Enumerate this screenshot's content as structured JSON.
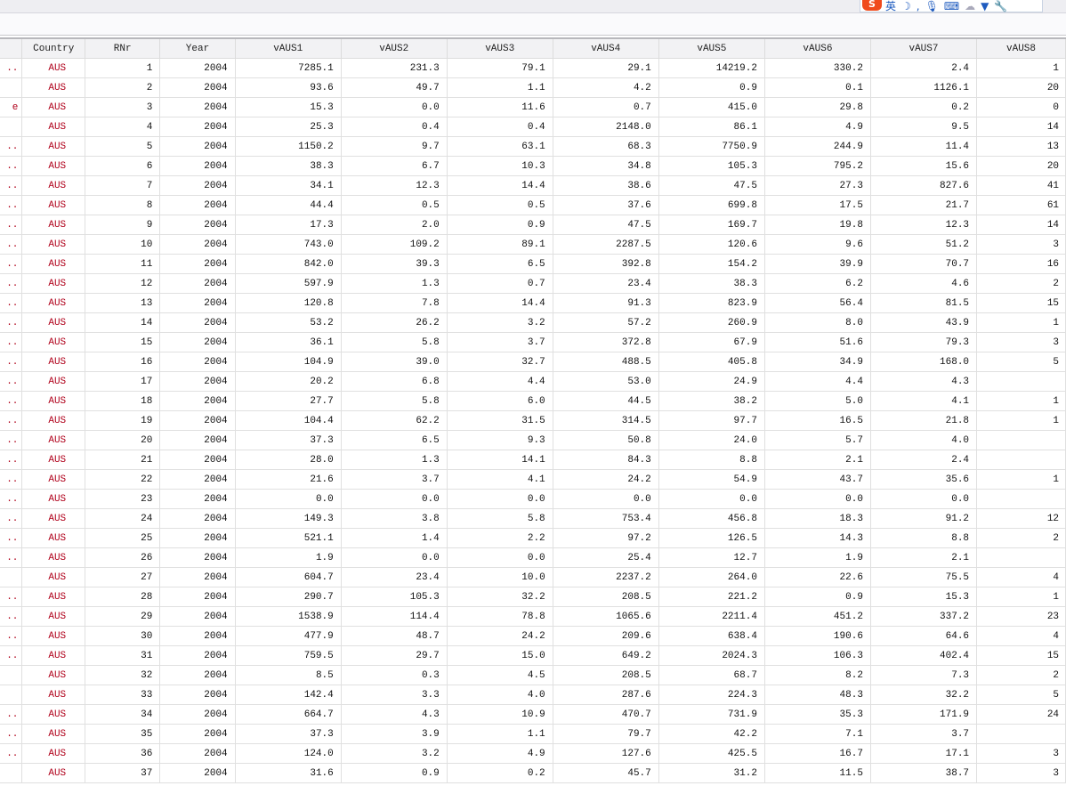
{
  "ime_toolbar": {
    "label": "英",
    "items": [
      "moon-icon",
      "punctuation-icon",
      "mic-icon",
      "keyboard-icon",
      "skin-icon",
      "shirt-icon",
      "wrench-icon"
    ]
  },
  "columns": [
    "",
    "Country",
    "RNr",
    "Year",
    "vAUS1",
    "vAUS2",
    "vAUS3",
    "vAUS4",
    "vAUS5",
    "vAUS6",
    "vAUS7",
    "vAUS8"
  ],
  "rows": [
    [
      "..",
      "AUS",
      "1",
      "2004",
      "7285.1",
      "231.3",
      "79.1",
      "29.1",
      "14219.2",
      "330.2",
      "2.4",
      "1"
    ],
    [
      "",
      "AUS",
      "2",
      "2004",
      "93.6",
      "49.7",
      "1.1",
      "4.2",
      "0.9",
      "0.1",
      "1126.1",
      "20"
    ],
    [
      "e",
      "AUS",
      "3",
      "2004",
      "15.3",
      "0.0",
      "11.6",
      "0.7",
      "415.0",
      "29.8",
      "0.2",
      "0"
    ],
    [
      "",
      "AUS",
      "4",
      "2004",
      "25.3",
      "0.4",
      "0.4",
      "2148.0",
      "86.1",
      "4.9",
      "9.5",
      "14"
    ],
    [
      "..",
      "AUS",
      "5",
      "2004",
      "1150.2",
      "9.7",
      "63.1",
      "68.3",
      "7750.9",
      "244.9",
      "11.4",
      "13"
    ],
    [
      "..",
      "AUS",
      "6",
      "2004",
      "38.3",
      "6.7",
      "10.3",
      "34.8",
      "105.3",
      "795.2",
      "15.6",
      "20"
    ],
    [
      "..",
      "AUS",
      "7",
      "2004",
      "34.1",
      "12.3",
      "14.4",
      "38.6",
      "47.5",
      "27.3",
      "827.6",
      "41"
    ],
    [
      "..",
      "AUS",
      "8",
      "2004",
      "44.4",
      "0.5",
      "0.5",
      "37.6",
      "699.8",
      "17.5",
      "21.7",
      "61"
    ],
    [
      "..",
      "AUS",
      "9",
      "2004",
      "17.3",
      "2.0",
      "0.9",
      "47.5",
      "169.7",
      "19.8",
      "12.3",
      "14"
    ],
    [
      "..",
      "AUS",
      "10",
      "2004",
      "743.0",
      "109.2",
      "89.1",
      "2287.5",
      "120.6",
      "9.6",
      "51.2",
      "3"
    ],
    [
      "..",
      "AUS",
      "11",
      "2004",
      "842.0",
      "39.3",
      "6.5",
      "392.8",
      "154.2",
      "39.9",
      "70.7",
      "16"
    ],
    [
      "..",
      "AUS",
      "12",
      "2004",
      "597.9",
      "1.3",
      "0.7",
      "23.4",
      "38.3",
      "6.2",
      "4.6",
      "2"
    ],
    [
      "..",
      "AUS",
      "13",
      "2004",
      "120.8",
      "7.8",
      "14.4",
      "91.3",
      "823.9",
      "56.4",
      "81.5",
      "15"
    ],
    [
      "..",
      "AUS",
      "14",
      "2004",
      "53.2",
      "26.2",
      "3.2",
      "57.2",
      "260.9",
      "8.0",
      "43.9",
      "1"
    ],
    [
      "..",
      "AUS",
      "15",
      "2004",
      "36.1",
      "5.8",
      "3.7",
      "372.8",
      "67.9",
      "51.6",
      "79.3",
      "3"
    ],
    [
      "..",
      "AUS",
      "16",
      "2004",
      "104.9",
      "39.0",
      "32.7",
      "488.5",
      "405.8",
      "34.9",
      "168.0",
      "5"
    ],
    [
      "..",
      "AUS",
      "17",
      "2004",
      "20.2",
      "6.8",
      "4.4",
      "53.0",
      "24.9",
      "4.4",
      "4.3",
      ""
    ],
    [
      "..",
      "AUS",
      "18",
      "2004",
      "27.7",
      "5.8",
      "6.0",
      "44.5",
      "38.2",
      "5.0",
      "4.1",
      "1"
    ],
    [
      "..",
      "AUS",
      "19",
      "2004",
      "104.4",
      "62.2",
      "31.5",
      "314.5",
      "97.7",
      "16.5",
      "21.8",
      "1"
    ],
    [
      "..",
      "AUS",
      "20",
      "2004",
      "37.3",
      "6.5",
      "9.3",
      "50.8",
      "24.0",
      "5.7",
      "4.0",
      ""
    ],
    [
      "..",
      "AUS",
      "21",
      "2004",
      "28.0",
      "1.3",
      "14.1",
      "84.3",
      "8.8",
      "2.1",
      "2.4",
      ""
    ],
    [
      "..",
      "AUS",
      "22",
      "2004",
      "21.6",
      "3.7",
      "4.1",
      "24.2",
      "54.9",
      "43.7",
      "35.6",
      "1"
    ],
    [
      "..",
      "AUS",
      "23",
      "2004",
      "0.0",
      "0.0",
      "0.0",
      "0.0",
      "0.0",
      "0.0",
      "0.0",
      ""
    ],
    [
      "..",
      "AUS",
      "24",
      "2004",
      "149.3",
      "3.8",
      "5.8",
      "753.4",
      "456.8",
      "18.3",
      "91.2",
      "12"
    ],
    [
      "..",
      "AUS",
      "25",
      "2004",
      "521.1",
      "1.4",
      "2.2",
      "97.2",
      "126.5",
      "14.3",
      "8.8",
      "2"
    ],
    [
      "..",
      "AUS",
      "26",
      "2004",
      "1.9",
      "0.0",
      "0.0",
      "25.4",
      "12.7",
      "1.9",
      "2.1",
      ""
    ],
    [
      "",
      "AUS",
      "27",
      "2004",
      "604.7",
      "23.4",
      "10.0",
      "2237.2",
      "264.0",
      "22.6",
      "75.5",
      "4"
    ],
    [
      "..",
      "AUS",
      "28",
      "2004",
      "290.7",
      "105.3",
      "32.2",
      "208.5",
      "221.2",
      "0.9",
      "15.3",
      "1"
    ],
    [
      "..",
      "AUS",
      "29",
      "2004",
      "1538.9",
      "114.4",
      "78.8",
      "1065.6",
      "2211.4",
      "451.2",
      "337.2",
      "23"
    ],
    [
      "..",
      "AUS",
      "30",
      "2004",
      "477.9",
      "48.7",
      "24.2",
      "209.6",
      "638.4",
      "190.6",
      "64.6",
      "4"
    ],
    [
      "..",
      "AUS",
      "31",
      "2004",
      "759.5",
      "29.7",
      "15.0",
      "649.2",
      "2024.3",
      "106.3",
      "402.4",
      "15"
    ],
    [
      "",
      "AUS",
      "32",
      "2004",
      "8.5",
      "0.3",
      "4.5",
      "208.5",
      "68.7",
      "8.2",
      "7.3",
      "2"
    ],
    [
      "",
      "AUS",
      "33",
      "2004",
      "142.4",
      "3.3",
      "4.0",
      "287.6",
      "224.3",
      "48.3",
      "32.2",
      "5"
    ],
    [
      "..",
      "AUS",
      "34",
      "2004",
      "664.7",
      "4.3",
      "10.9",
      "470.7",
      "731.9",
      "35.3",
      "171.9",
      "24"
    ],
    [
      "..",
      "AUS",
      "35",
      "2004",
      "37.3",
      "3.9",
      "1.1",
      "79.7",
      "42.2",
      "7.1",
      "3.7",
      ""
    ],
    [
      "..",
      "AUS",
      "36",
      "2004",
      "124.0",
      "3.2",
      "4.9",
      "127.6",
      "425.5",
      "16.7",
      "17.1",
      "3"
    ],
    [
      "",
      "AUS",
      "37",
      "2004",
      "31.6",
      "0.9",
      "0.2",
      "45.7",
      "31.2",
      "11.5",
      "38.7",
      "3"
    ]
  ]
}
